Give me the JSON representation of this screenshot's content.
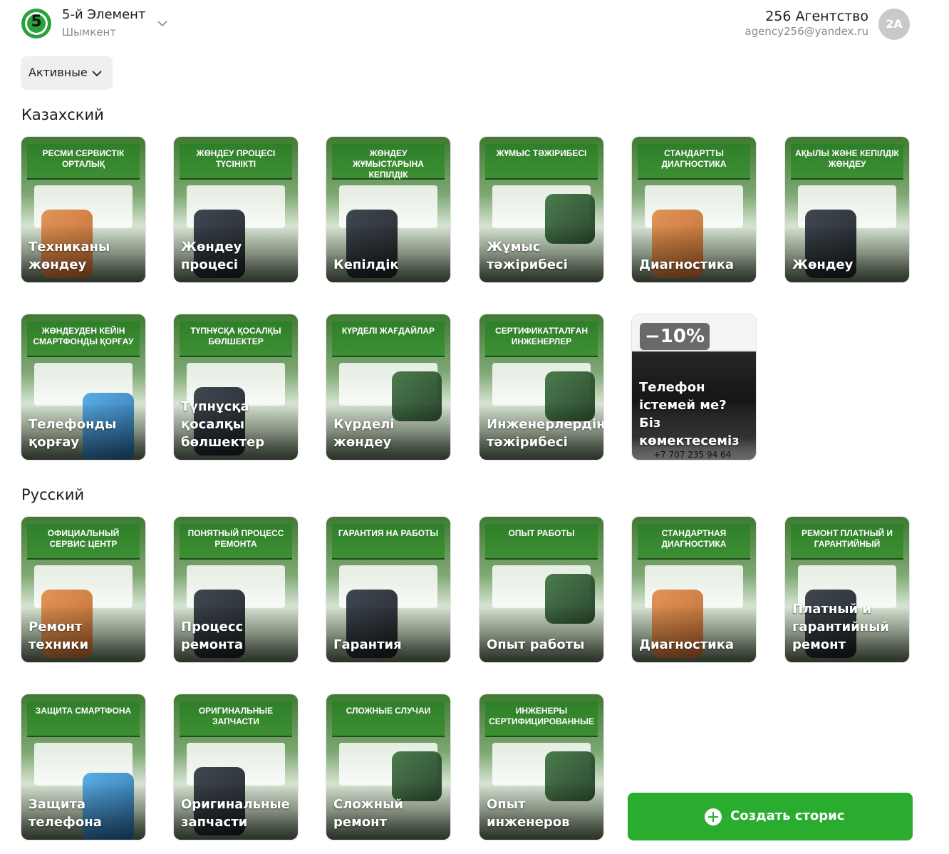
{
  "header": {
    "logo_digit": "5",
    "store_name": "5-й Элемент",
    "store_city": "Шымкент",
    "agency_name": "256 Агентство",
    "agency_email": "agency256@yandex.ru",
    "avatar_initials": "2A"
  },
  "filter": {
    "label": "Активные"
  },
  "sections": {
    "kazakh": {
      "title": "Казахский",
      "cards": [
        {
          "band": "РЕСМИ СЕРВИСТІК ОРТАЛЫҚ",
          "title": "Техниканы жөндеу"
        },
        {
          "band": "ЖӨНДЕУ ПРОЦЕСІ ТҮСІНІКТІ",
          "title": "Жөндеу процесі"
        },
        {
          "band": "ЖӨНДЕУ ЖҰМЫСТАРЫНА КЕПІЛДІК",
          "title": "Кепілдік"
        },
        {
          "band": "ЖҰМЫС ТӘЖІРИБЕСІ",
          "title": "Жұмыс тәжірибесі"
        },
        {
          "band": "СТАНДАРТТЫ диагностика",
          "title": "Диагностика"
        },
        {
          "band": "АҚЫЛЫ ЖӘНЕ КЕПІЛДІК ЖӨНДЕУ",
          "title": "Жөндеу"
        },
        {
          "band": "ЖӨНДЕУДЕН КЕЙІН СМАРТФОНДЫ ҚОРҒАУ",
          "title": "Телефонды қорғау"
        },
        {
          "band": "ТҮПНҰСҚА ҚОСАЛҚЫ БӨЛШЕКТЕР",
          "title": "Түпнұсқа қосалқы бөлшектер"
        },
        {
          "band": "КҮРДЕЛІ ЖАҒДАЙЛАР",
          "title": "Күрделі жөндеу"
        },
        {
          "band": "СЕРТИФИКАТТАЛҒАН ИНЖЕНЕРЛЕР",
          "title": "Инженерлердің тәжірибесі"
        },
        {
          "discount": "−10%",
          "title": "Телефон істемей ме? Біз көмектесеміз",
          "phone": "+7 707 235 94 64"
        }
      ]
    },
    "russian": {
      "title": "Русский",
      "cards": [
        {
          "band": "ОФИЦИАЛЬНЫЙ СЕРВИС ЦЕНТР",
          "title": "Ремонт техники"
        },
        {
          "band": "ПОНЯТНЫЙ процесс ремонта",
          "title": "Процесс ремонта"
        },
        {
          "band": "ГАРАНТИЯ на работы",
          "title": "Гарантия"
        },
        {
          "band": "ОПЫТ работы",
          "title": "Опыт работы"
        },
        {
          "band": "СТАНДАРТНАЯ диагностика",
          "title": "Диагностика"
        },
        {
          "band": "РЕМОНТ ПЛАТНЫЙ и гарантийный",
          "title": "Платный и гарантийный ремонт"
        },
        {
          "band": "ЗАЩИТА СМАРТФОНА",
          "title": "Защита телефона"
        },
        {
          "band": "ОРИГИНАЛЬНЫЕ запчасти",
          "title": "Оригинальные запчасти"
        },
        {
          "band": "СЛОЖНЫЕ СЛУЧАИ",
          "title": "Сложный ремонт"
        },
        {
          "band": "ИНЖЕНЕРЫ сертифицированные",
          "title": "Опыт инженеров"
        }
      ]
    }
  },
  "create_button": {
    "label": "Создать сторис"
  },
  "colors": {
    "brand_green": "#2aad2f",
    "card_green": "#3d8f33"
  }
}
